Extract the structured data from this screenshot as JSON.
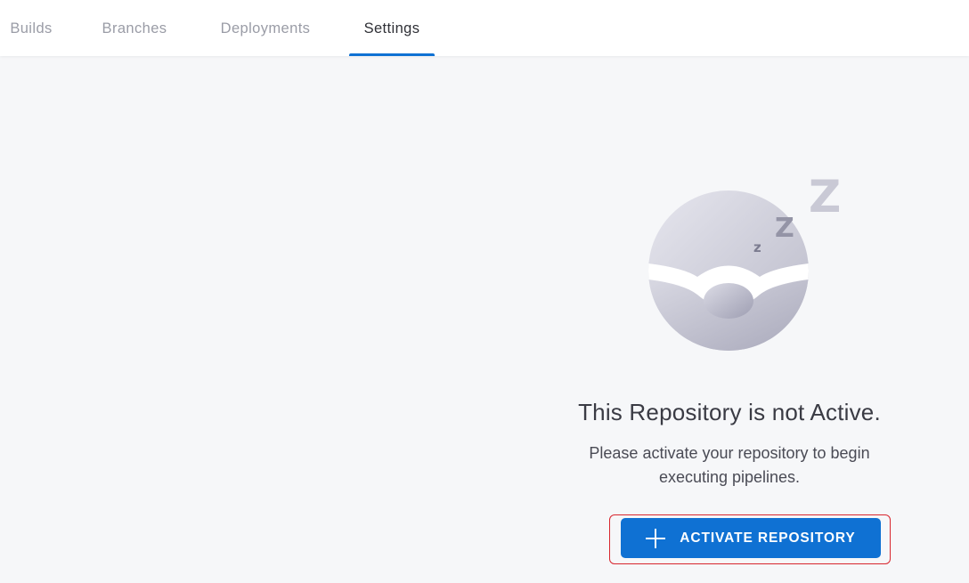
{
  "tabs": [
    {
      "label": "Builds"
    },
    {
      "label": "Branches"
    },
    {
      "label": "Deployments"
    },
    {
      "label": "Settings",
      "active": true
    }
  ],
  "colors": {
    "accent": "#0f71d3",
    "highlight_outline": "#d8262e"
  },
  "empty_state": {
    "illustration_icon": "sleeping-ball-icon",
    "title": "This Repository is not Active.",
    "description": "Please activate your repository to begin executing pipelines.",
    "button_icon": "plus-icon",
    "button_label": "ACTIVATE REPOSITORY"
  }
}
